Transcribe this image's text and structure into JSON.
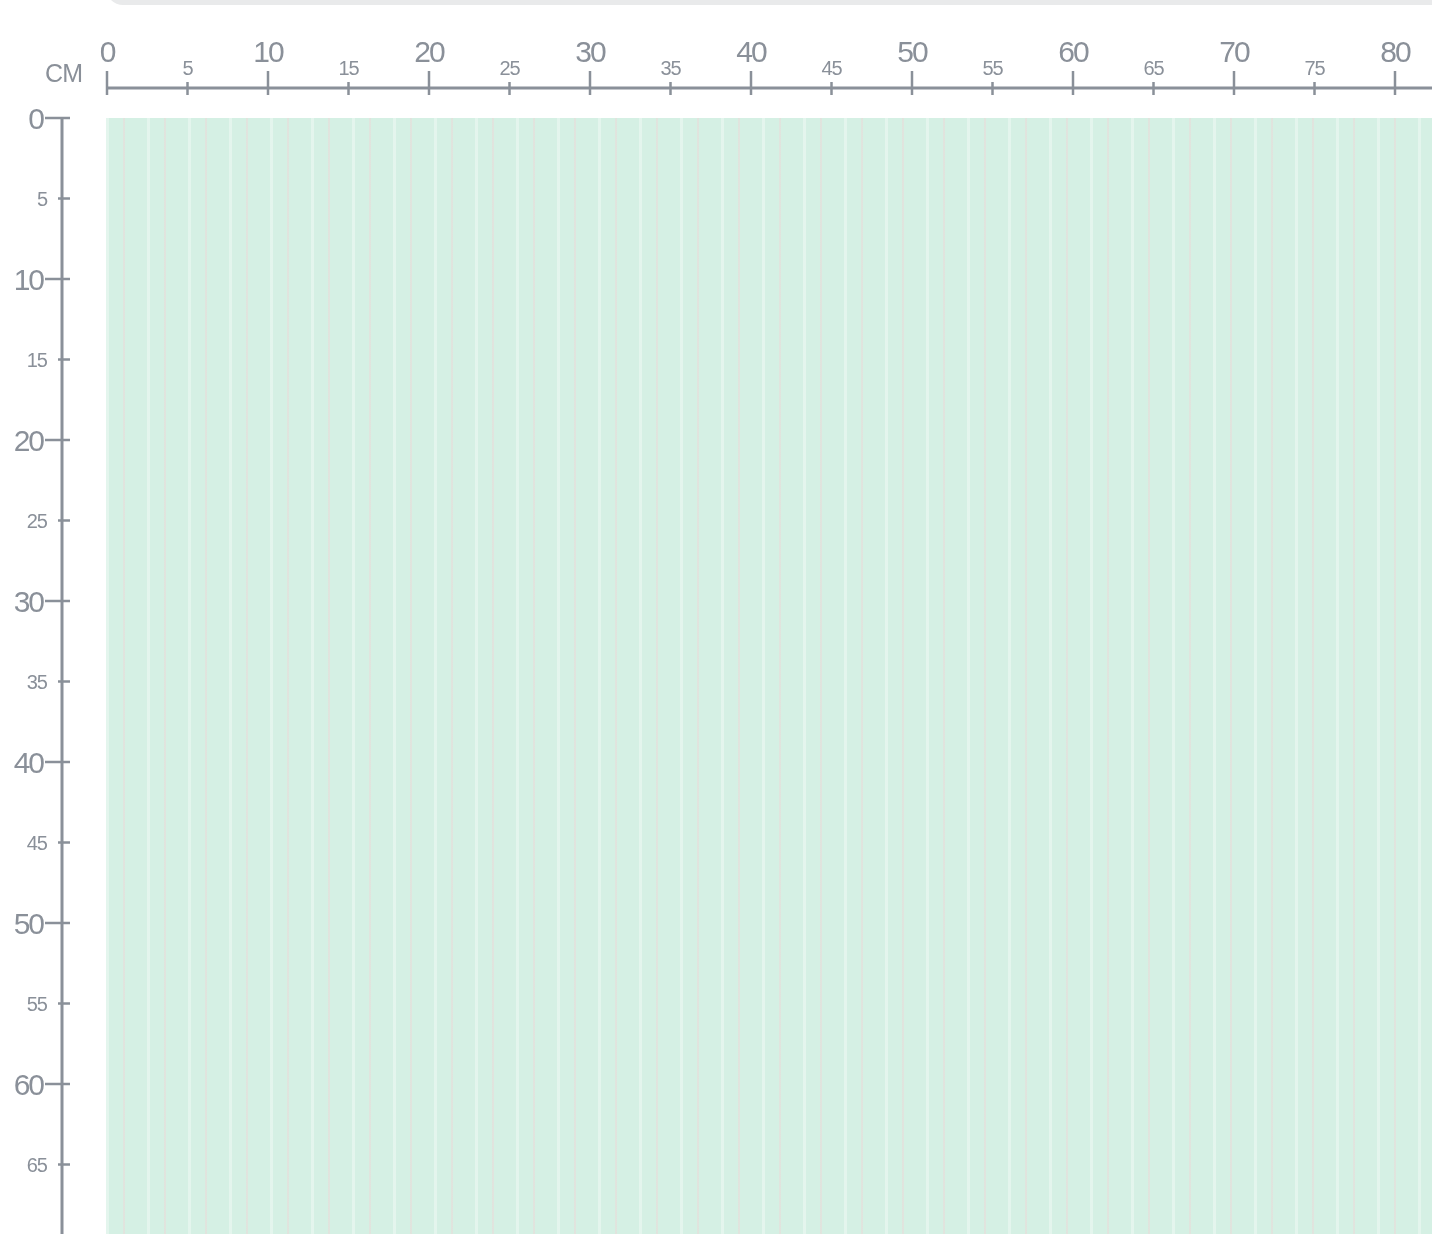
{
  "unit": "CM",
  "top_ruler": {
    "labels": [
      "0",
      "5",
      "10",
      "15",
      "20",
      "25",
      "30",
      "35",
      "40",
      "45",
      "50",
      "55",
      "60",
      "65",
      "70",
      "75",
      "80"
    ]
  },
  "left_ruler": {
    "labels": [
      "0",
      "5",
      "10",
      "15",
      "20",
      "25",
      "30",
      "35",
      "40",
      "45",
      "50",
      "55",
      "60",
      "65"
    ]
  },
  "fabric": {
    "kind": "pattern"
  }
}
